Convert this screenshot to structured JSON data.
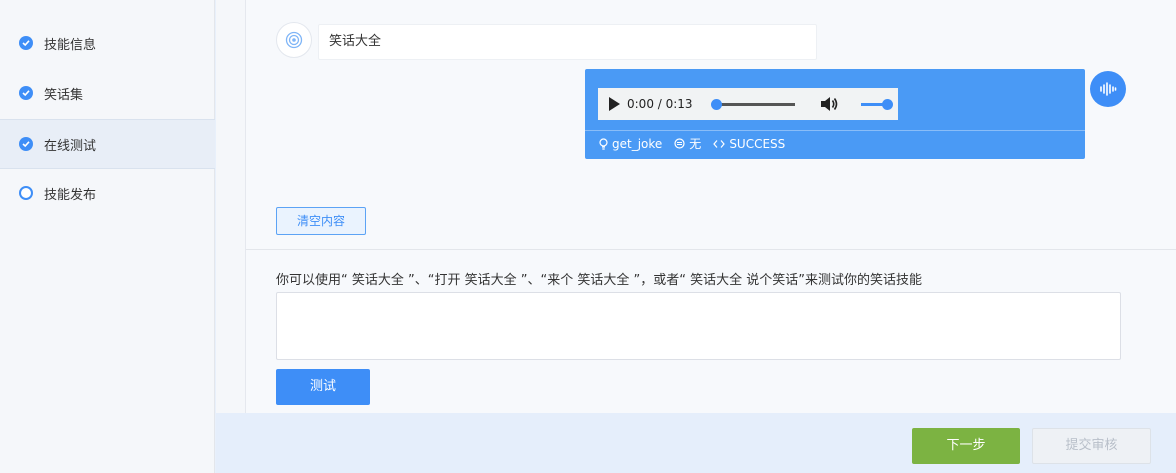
{
  "sidebar": {
    "steps": [
      {
        "label": "技能信息",
        "state": "done"
      },
      {
        "label": "笑话集",
        "state": "done"
      },
      {
        "label": "在线测试",
        "state": "done-active"
      },
      {
        "label": "技能发布",
        "state": "pending"
      }
    ]
  },
  "chat": {
    "bot_message": "笑话大全",
    "audio": {
      "time": "0:00 / 0:13",
      "progress": 0
    },
    "meta": {
      "intent": "get_joke",
      "slot": "无",
      "status": "SUCCESS"
    }
  },
  "clear_label": "清空内容",
  "hint": "你可以使用“ 笑话大全 ”、“打开 笑话大全 ”、“来个 笑话大全 ”，或者“ 笑话大全 说个笑话”来测试你的笑话技能",
  "test_input": {
    "value": "",
    "placeholder": ""
  },
  "test_label": "测试",
  "footer": {
    "next_label": "下一步",
    "submit_label": "提交审核"
  },
  "colors": {
    "accent": "#3e8ef7",
    "green": "#7cb342",
    "card": "#4a9af5"
  }
}
